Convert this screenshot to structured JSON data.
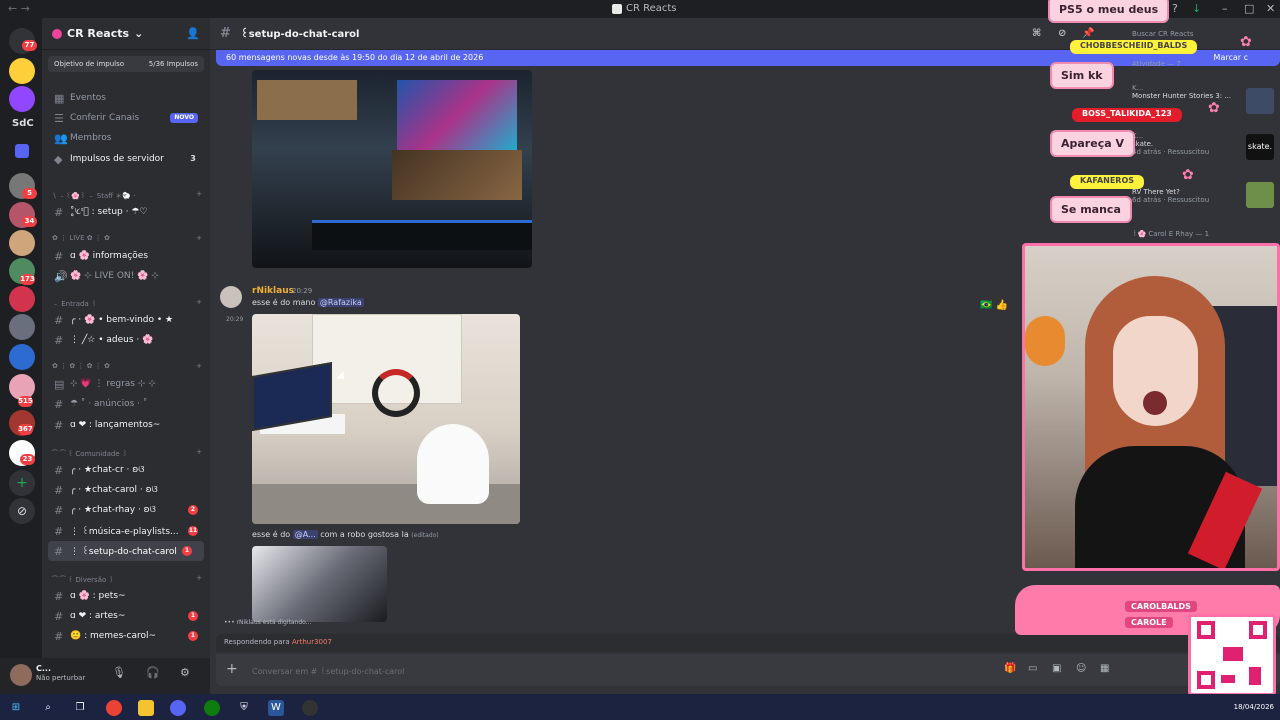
{
  "window": {
    "title": "CR Reacts"
  },
  "servers": {
    "label_sdc": "SdC",
    "badges": [
      "77",
      "5",
      "34",
      "173",
      "515",
      "367",
      "23"
    ]
  },
  "server": {
    "name": "CR Reacts",
    "boost_goal": "Objetivo de impulso",
    "boost_progress": "5/36 Impulsos"
  },
  "menu": [
    {
      "label": "Eventos"
    },
    {
      "label": "Conferir Canais",
      "tag": "NOVO"
    },
    {
      "label": "Membros"
    },
    {
      "label": "Impulsos de servidor",
      "count": "3"
    }
  ],
  "categories": {
    "staff": "∖ ﹣꒰🌸꒱ ﹣ Staff ＊🐑 ·",
    "live": "✿ ⋮ LIVE ✿ ⋮ ✿",
    "entrada": "﹣ Entrada ꒱",
    "info2": "✿ ⋮ ✿ ⋮ ✿ ⋮ ✿",
    "comunidade": "⁀ ⁀ ꒰ Comunidade ꒱",
    "diversao": "⁀ ⁀ ꒰ Diversão ꒱"
  },
  "channels": [
    {
      "name": "˳̊ᵎ૮ᶦ᪲ : setup · ☂♡"
    },
    {
      "name": "ɑ 🌸 informações"
    },
    {
      "name": "🌸 ⊹ LIVE ON! 🌸 ⊹"
    },
    {
      "name": "╭ · 🌸 • bem-vindo • ★"
    },
    {
      "name": "⋮ ╱☆ • adeus · 🌸"
    },
    {
      "name": "⊹ 💗 ⋮ regras ⊹ ⊹"
    },
    {
      "name": "☂ ˚ · anúncios · ˚"
    },
    {
      "name": "ɑ ❤ : lançamentos~"
    },
    {
      "name": "╭ · ★chat-cr · ʚଓ"
    },
    {
      "name": "╭ · ★chat-carol · ʚଓ"
    },
    {
      "name": "╭ · ★chat-rhay · ʚଓ",
      "badge": "2"
    },
    {
      "name": "⋮ ꒰música-e-playlists...",
      "badge": "11"
    },
    {
      "name": "⋮ ꒰setup-do-chat-carol",
      "badge": "1"
    },
    {
      "name": "ɑ 🌸 : pets~"
    },
    {
      "name": "ɑ ❤ : artes~",
      "badge": "1"
    },
    {
      "name": "🙂 : memes-carol~",
      "badge": "1"
    }
  ],
  "user": {
    "name": "C...",
    "status": "Não perturbar"
  },
  "channel_header": {
    "name": "꒰setup-do-chat-carol"
  },
  "new_messages": {
    "text": "60 mensagens novas desde às 19:50 do dia 12 de abril de 2026",
    "action": "Marcar c"
  },
  "messages": [
    {
      "author": "rNiklaus",
      "time": "20:29",
      "text_prefix": "esse é do mano ",
      "mention": "@Rafazika",
      "side_time": "20:29"
    },
    {
      "text_prefix": "esse é do ",
      "mention": "@A...",
      "text_suffix": " com a robo gostosa la",
      "edited": "(editado)"
    }
  ],
  "typing": "rNiklaus está digitando...",
  "reply": {
    "prefix": "Respondendo para ",
    "who": "Arthur3007"
  },
  "composer": {
    "placeholder": "Conversar em # ꒰setup-do-chat-carol"
  },
  "overlay": {
    "bubbles": [
      "PS5 o meu deus",
      "Sim kk",
      "Apareça V",
      "Se manca"
    ],
    "tags": [
      "CHOBBESCHEIID_BALDS",
      "BOSS_TALIKIDA_123",
      "KAFANEROS"
    ],
    "social": [
      "CAROLBALDS",
      "CAROLE"
    ]
  },
  "activity": {
    "search": "Buscar CR Reacts",
    "title": "Atividade — 7",
    "items": [
      {
        "user": "K...",
        "game": "Monster Hunter Stories 3: ..."
      },
      {
        "user": "K...",
        "game": "skate.",
        "meta": "4d atrás · Ressuscitou"
      },
      {
        "user": "K...",
        "game": "RV There Yet?",
        "meta": "6d atrás · Ressuscitou"
      }
    ],
    "footer": "꒰🌸 Carol E Rhay — 1",
    "ligado": "LIGADO",
    "bottom_user": "1with",
    "bottom_user2": "@Clip"
  },
  "taskbar": {
    "date": "18/04/2026"
  }
}
